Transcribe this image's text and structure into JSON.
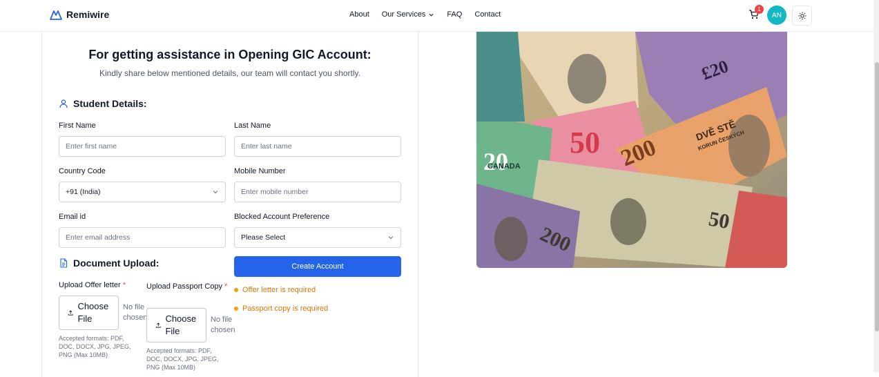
{
  "header": {
    "brand": "Remiwire",
    "nav": [
      {
        "label": "About"
      },
      {
        "label": "Our Services"
      },
      {
        "label": "FAQ"
      },
      {
        "label": "Contact"
      }
    ],
    "cart_count": "1",
    "avatar_initials": "AN"
  },
  "form": {
    "title": "For getting assistance in Opening GIC Account:",
    "subtitle": "Kindly share below mentioned details, our team will contact you shortly.",
    "student_section": "Student Details:",
    "first_name": {
      "label": "First Name",
      "placeholder": "Enter first name"
    },
    "last_name": {
      "label": "Last Name",
      "placeholder": "Enter last name"
    },
    "country_code": {
      "label": "Country Code",
      "value": "+91 (India)"
    },
    "mobile": {
      "label": "Mobile Number",
      "placeholder": "Enter mobile number"
    },
    "email": {
      "label": "Email id",
      "placeholder": "Enter email address"
    },
    "blocked_pref": {
      "label": "Blocked Account Preference",
      "value": "Please Select"
    },
    "document_section": "Document Upload:",
    "offer_letter": {
      "label": "Upload Offer letter",
      "required": "*",
      "button": "Choose File",
      "status": "No file chosen",
      "hint": "Accepted formats: PDF, DOC, DOCX, JPG, JPEG, PNG (Max 10MB)"
    },
    "passport": {
      "label": "Upload Passport Copy",
      "required": "*",
      "button": "Choose File",
      "status": "No file chosen",
      "hint": "Accepted formats: PDF, DOC, DOCX, JPG, JPEG, PNG (Max 10MB)"
    },
    "submit": "Create Account",
    "errors": [
      "Offer letter is required",
      "Passport copy is required"
    ]
  },
  "image": {
    "notes": [
      "20",
      "50",
      "200",
      "200",
      "50",
      "£20"
    ],
    "words": [
      "CANADA",
      "DVĚ STĚ",
      "KORUN ČESKÝCH"
    ]
  },
  "colors": {
    "primary": "#2563eb",
    "error": "#d97706",
    "avatar": "#14b8c4",
    "badge": "#ef4444"
  }
}
